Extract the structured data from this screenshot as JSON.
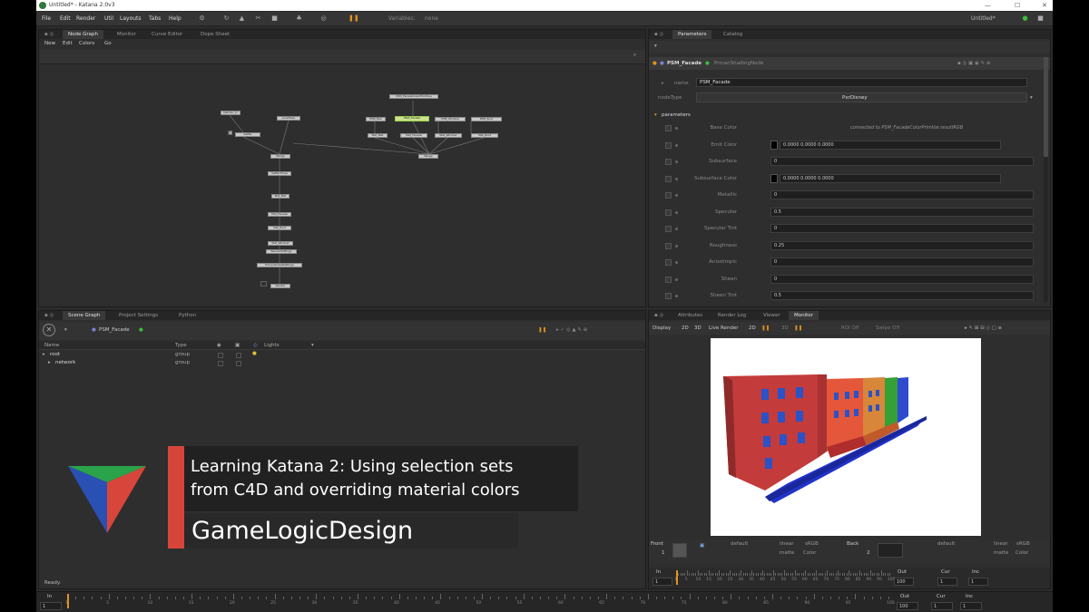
{
  "app": {
    "title": "Untitled* - Katana 2.0v3"
  },
  "menu": {
    "items": [
      "File",
      "Edit",
      "Render",
      "Util",
      "Layouts",
      "Tabs",
      "Help"
    ],
    "variables_label": "Variables:",
    "variables_value": "none",
    "project_dropdown": "Untitled*"
  },
  "node_graph": {
    "tabs": [
      "Node Graph",
      "Monitor",
      "Curve Editor",
      "Dope Sheet"
    ],
    "menu": [
      "New",
      "Edit",
      "Colors",
      "Go"
    ],
    "nodes": [
      {
        "label": "PSM_FacadeColorPrimitive"
      },
      {
        "label": "Alembic_In"
      },
      {
        "label": "LookFileIn"
      },
      {
        "label": "PSM_Ball"
      },
      {
        "label": "PSM_Facade"
      },
      {
        "label": "PSM_Window"
      },
      {
        "label": "PSM_Roof"
      },
      {
        "label": "Gaffer"
      },
      {
        "label": "Merge"
      },
      {
        "label": "Merge"
      },
      {
        "label": "GafferThree"
      },
      {
        "label": "Mat_Ball"
      },
      {
        "label": "Mat_Facade"
      },
      {
        "label": "Mat_Window"
      },
      {
        "label": "Mat_Roof"
      },
      {
        "label": "MaterialAssign"
      },
      {
        "label": "RenderSettings"
      },
      {
        "label": "PrmanGlobalSettings"
      },
      {
        "label": "Render"
      }
    ]
  },
  "parameters": {
    "tabs": [
      "Parameters",
      "Catalog"
    ],
    "node_name": "PSM_Facade",
    "node_type_title": "PrmanShadingNode",
    "name_label": "name",
    "name_value": "PSM_Facade",
    "nodetype_label": "nodeType",
    "nodetype_value": "PxrDisney",
    "section": "parameters",
    "rows": [
      {
        "label": "Base Color",
        "value": "connected to PSM_FacadeColorPrimVar.resultRGB"
      },
      {
        "label": "Emit Color",
        "value": "0.0000  0.0000  0.0000"
      },
      {
        "label": "Subsurface",
        "value": "0"
      },
      {
        "label": "Subsurface Color",
        "value": "0.0000  0.0000  0.0000"
      },
      {
        "label": "Metallic",
        "value": "0"
      },
      {
        "label": "Specular",
        "value": "0.5"
      },
      {
        "label": "Specular Tint",
        "value": "0"
      },
      {
        "label": "Roughness",
        "value": "0.25"
      },
      {
        "label": "Anisotropic",
        "value": "0"
      },
      {
        "label": "Sheen",
        "value": "0"
      },
      {
        "label": "Sheen Tint",
        "value": "0.5"
      }
    ]
  },
  "scene_graph": {
    "tabs": [
      "Scene Graph",
      "Project Settings",
      "Python"
    ],
    "selected": "PSM_Facade",
    "columns": [
      "Name",
      "Type",
      "Lights"
    ],
    "rows": [
      {
        "name": "root",
        "type": "group"
      },
      {
        "name": "network",
        "type": "group"
      }
    ],
    "status": "Ready."
  },
  "monitor": {
    "tabs": [
      "Attributes",
      "Render Log",
      "Viewer",
      "Monitor"
    ],
    "toolbar": [
      "Display",
      "2D",
      "3D",
      "Live Render",
      "2D",
      "3D"
    ],
    "roi_label": "ROI Off",
    "swipe_label": "Swipe Off",
    "frame_label": "Front",
    "frame_number": "1",
    "fields": [
      "default",
      "linear",
      "sRGB",
      "matte",
      "Color",
      "default",
      "linear",
      "sRGB",
      "matte",
      "Color"
    ],
    "back_label": "Back",
    "back_number": "2"
  },
  "overlay": {
    "title_line1": "Learning Katana 2: Using selection sets",
    "title_line2": "from C4D and overriding material colors",
    "brand": "GameLogicDesign"
  },
  "timeline": {
    "in_label": "In",
    "out_label": "Out",
    "cur_label": "Cur",
    "inc_label": "Inc",
    "in_value": "1",
    "out_value": "100",
    "cur_value": "1",
    "inc_value": "1",
    "ticks": [
      "1",
      "5",
      "10",
      "15",
      "20",
      "25",
      "30",
      "35",
      "40",
      "45",
      "50",
      "55",
      "60",
      "65",
      "70",
      "75",
      "80",
      "85",
      "90",
      "95",
      "100"
    ]
  }
}
